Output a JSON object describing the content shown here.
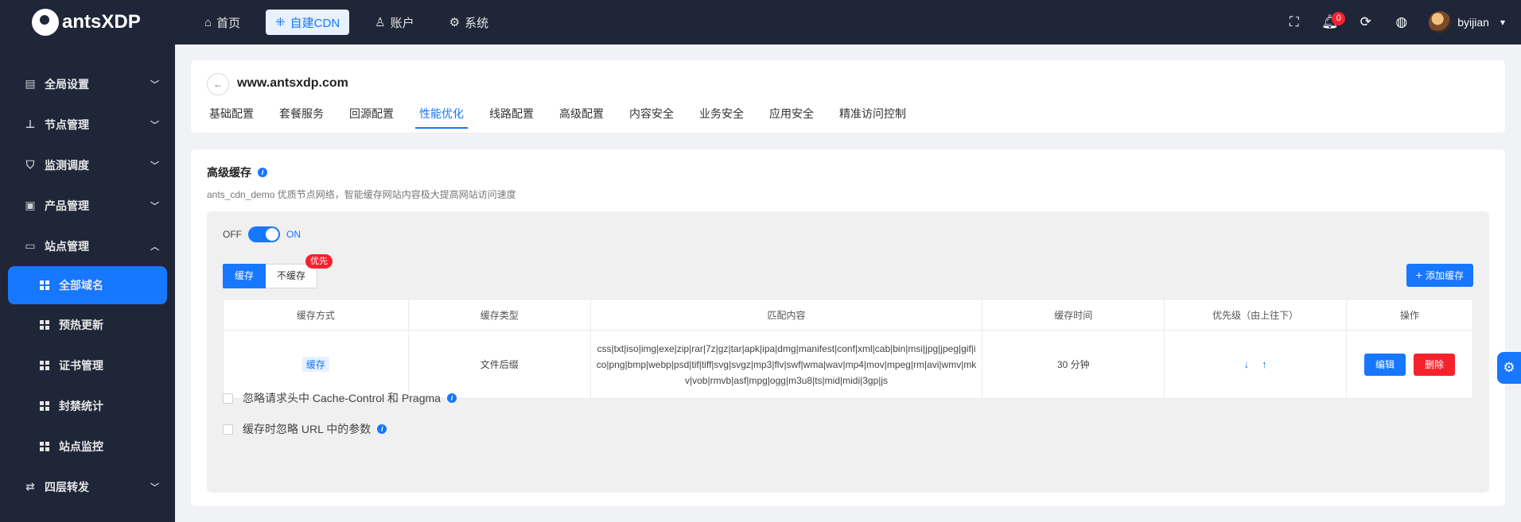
{
  "brand": {
    "name": "antsXDP"
  },
  "topnav": [
    {
      "label": "首页",
      "icon": "home-icon"
    },
    {
      "label": "自建CDN",
      "icon": "cdn-icon",
      "active": true
    },
    {
      "label": "账户",
      "icon": "user-icon"
    },
    {
      "label": "系统",
      "icon": "gear-icon"
    }
  ],
  "topbar": {
    "notification_count": "0",
    "username": "byijian"
  },
  "sidebar": {
    "groups": [
      {
        "label": "全局设置",
        "icon": "settings-icon"
      },
      {
        "label": "节点管理",
        "icon": "node-icon"
      },
      {
        "label": "监测调度",
        "icon": "shield-icon"
      },
      {
        "label": "产品管理",
        "icon": "product-icon"
      },
      {
        "label": "站点管理",
        "icon": "site-icon"
      },
      {
        "label": "四层转发",
        "icon": "forward-icon"
      }
    ],
    "sub_items": [
      {
        "label": "全部域名",
        "active": true
      },
      {
        "label": "预热更新"
      },
      {
        "label": "证书管理"
      },
      {
        "label": "封禁统计"
      },
      {
        "label": "站点监控"
      }
    ]
  },
  "header": {
    "domain": "www.antsxdp.com",
    "tabs": [
      "基础配置",
      "套餐服务",
      "回源配置",
      "性能优化",
      "线路配置",
      "高级配置",
      "内容安全",
      "业务安全",
      "应用安全",
      "精准访问控制"
    ],
    "active_tab": "性能优化"
  },
  "section": {
    "title": "高级缓存",
    "description": "ants_cdn_demo 优质节点网络，智能缓存网站内容极大提高网站访问速度",
    "switch_off": "OFF",
    "switch_on": "ON",
    "switch_state": true,
    "seg_cache": "缓存",
    "seg_nocache": "不缓存",
    "priority_badge": "优先",
    "add_button": "添加缓存"
  },
  "table": {
    "columns": [
      "缓存方式",
      "缓存类型",
      "匹配内容",
      "缓存时间",
      "优先级（由上往下）",
      "操作"
    ],
    "rows": [
      {
        "method": "缓存",
        "type": "文件后缀",
        "match": "css|txt|iso|img|exe|zip|rar|7z|gz|tar|apk|ipa|dmg|manifest|conf|xml|cab|bin|msi|jpg|jpeg|gif|ico|png|bmp|webp|psd|tif|tiff|svg|svgz|mp3|flv|swf|wma|wav|mp4|mov|mpeg|rm|avi|wmv|mkv|vob|rmvb|asf|mpg|ogg|m3u8|ts|mid|midi|3gp|js",
        "time": "30 分钟",
        "edit_label": "编辑",
        "delete_label": "删除"
      }
    ]
  },
  "options": {
    "ignore_headers": "忽略请求头中 Cache-Control 和 Pragma",
    "ignore_params": "缓存时忽略 URL 中的参数"
  },
  "colors": {
    "primary": "#1677ff",
    "danger": "#f5222d",
    "dark": "#1f2638"
  }
}
